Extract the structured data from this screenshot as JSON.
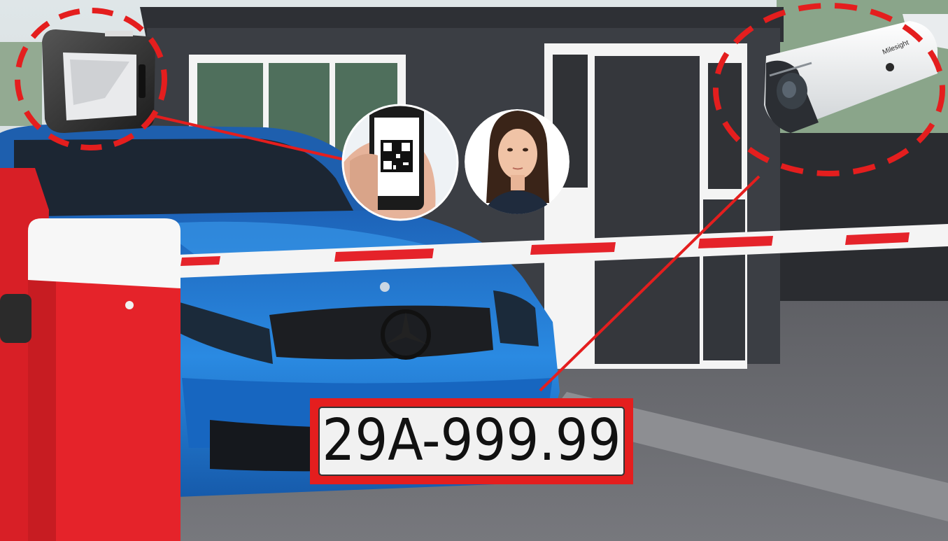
{
  "plate": {
    "number": "29A-999.99"
  },
  "camera": {
    "brand": "Milesight"
  },
  "icons": [
    "qr-code-icon",
    "face-portrait-icon",
    "barcode-scanner-icon",
    "bullet-camera-icon",
    "barrier-gate-icon"
  ],
  "colors": {
    "highlight_red": "#e41e1e",
    "car_blue": "#1f78d4",
    "booth_dark": "#3b3e44",
    "barrier_red": "#e5232a",
    "ground": "#6e6f74"
  }
}
